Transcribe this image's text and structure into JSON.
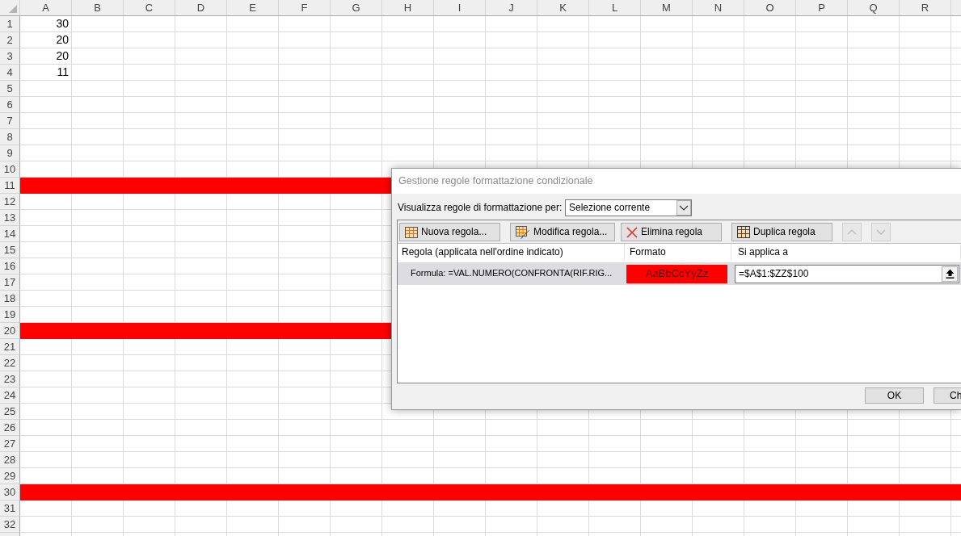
{
  "sheet": {
    "columns": [
      "A",
      "B",
      "C",
      "D",
      "E",
      "F",
      "G",
      "H",
      "I",
      "J",
      "K",
      "L",
      "M",
      "N",
      "O",
      "P",
      "Q",
      "R"
    ],
    "rows": [
      {
        "label": "1",
        "highlighted": false,
        "cells": [
          "30"
        ]
      },
      {
        "label": "2",
        "highlighted": false,
        "cells": [
          "20"
        ]
      },
      {
        "label": "3",
        "highlighted": false,
        "cells": [
          "20"
        ]
      },
      {
        "label": "4",
        "highlighted": false,
        "cells": [
          "11"
        ]
      },
      {
        "label": "5",
        "highlighted": false
      },
      {
        "label": "6",
        "highlighted": false
      },
      {
        "label": "7",
        "highlighted": false
      },
      {
        "label": "8",
        "highlighted": false
      },
      {
        "label": "9",
        "highlighted": false
      },
      {
        "label": "10",
        "highlighted": false
      },
      {
        "label": "11",
        "highlighted": true
      },
      {
        "label": "12",
        "highlighted": false
      },
      {
        "label": "13",
        "highlighted": false
      },
      {
        "label": "14",
        "highlighted": false
      },
      {
        "label": "15",
        "highlighted": false
      },
      {
        "label": "16",
        "highlighted": false
      },
      {
        "label": "17",
        "highlighted": false
      },
      {
        "label": "18",
        "highlighted": false
      },
      {
        "label": "19",
        "highlighted": false
      },
      {
        "label": "20",
        "highlighted": true
      },
      {
        "label": "21",
        "highlighted": false
      },
      {
        "label": "22",
        "highlighted": false
      },
      {
        "label": "23",
        "highlighted": false
      },
      {
        "label": "24",
        "highlighted": false
      },
      {
        "label": "25",
        "highlighted": false
      },
      {
        "label": "26",
        "highlighted": false
      },
      {
        "label": "27",
        "highlighted": false
      },
      {
        "label": "28",
        "highlighted": false
      },
      {
        "label": "29",
        "highlighted": false
      },
      {
        "label": "30",
        "highlighted": true
      },
      {
        "label": "31",
        "highlighted": false
      },
      {
        "label": "32",
        "highlighted": false
      }
    ]
  },
  "dialog": {
    "title": "Gestione regole formattazione condizionale",
    "show_rules_for": {
      "label": "Visualizza regole di formattazione per:",
      "value": "Selezione corrente"
    },
    "toolbar": [
      {
        "kind": "new",
        "label": "Nuova regola...",
        "disabled": false
      },
      {
        "kind": "edit",
        "label": "Modifica regola...",
        "disabled": false
      },
      {
        "kind": "delete",
        "label": "Elimina regola",
        "disabled": false
      },
      {
        "kind": "duplicate",
        "label": "Duplica regola",
        "disabled": false
      },
      {
        "kind": "up",
        "disabled": true
      },
      {
        "kind": "down",
        "disabled": true
      }
    ],
    "columns": [
      "Regola (applicata nell'ordine indicato)",
      "Formato",
      "Si applica a"
    ],
    "rules": [
      {
        "rule": "Formula: =VAL.NUMERO(CONFRONTA(RIF.RIG...",
        "format_preview": "AaBbCcYyZz",
        "applies_to": "=$A$1:$ZZ$100",
        "selected": true
      }
    ],
    "buttons": [
      "OK",
      "Ch"
    ]
  }
}
